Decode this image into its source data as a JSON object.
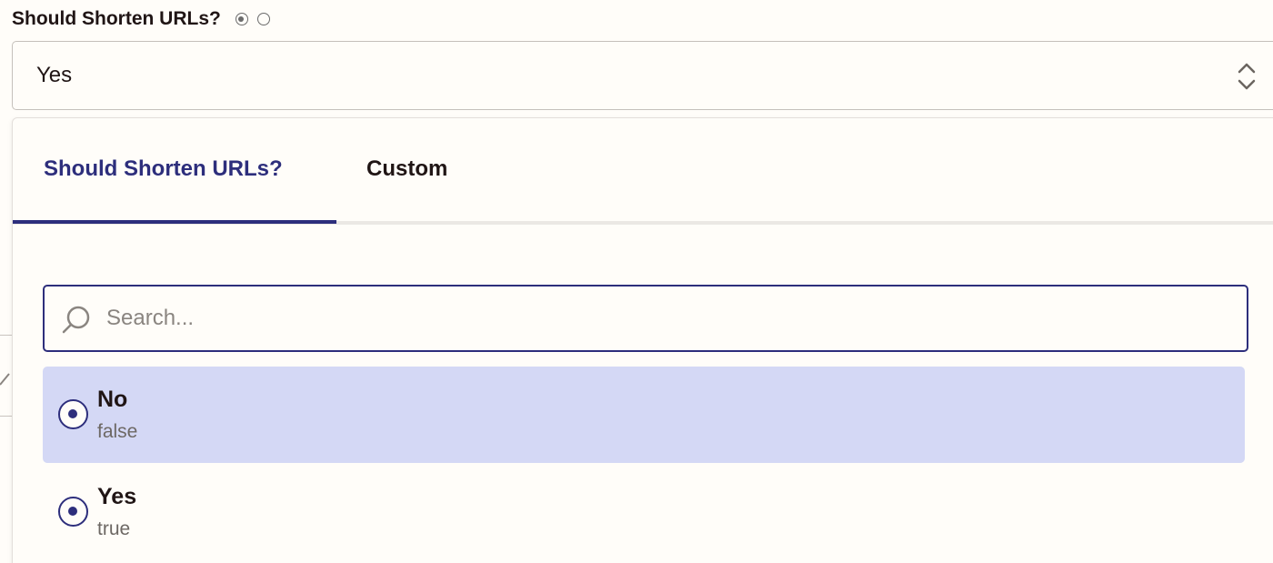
{
  "field": {
    "label": "Should Shorten URLs?",
    "selected_value": "Yes"
  },
  "tabs": [
    {
      "label": "Should Shorten URLs?",
      "active": true
    },
    {
      "label": "Custom",
      "active": false
    }
  ],
  "search": {
    "placeholder": "Search...",
    "value": ""
  },
  "options": [
    {
      "label": "No",
      "value": "false",
      "highlighted": true
    },
    {
      "label": "Yes",
      "value": "true",
      "highlighted": false
    }
  ],
  "colors": {
    "accent": "#2d2e7c",
    "highlight": "#d4d8f5",
    "background": "#fffdf9"
  }
}
